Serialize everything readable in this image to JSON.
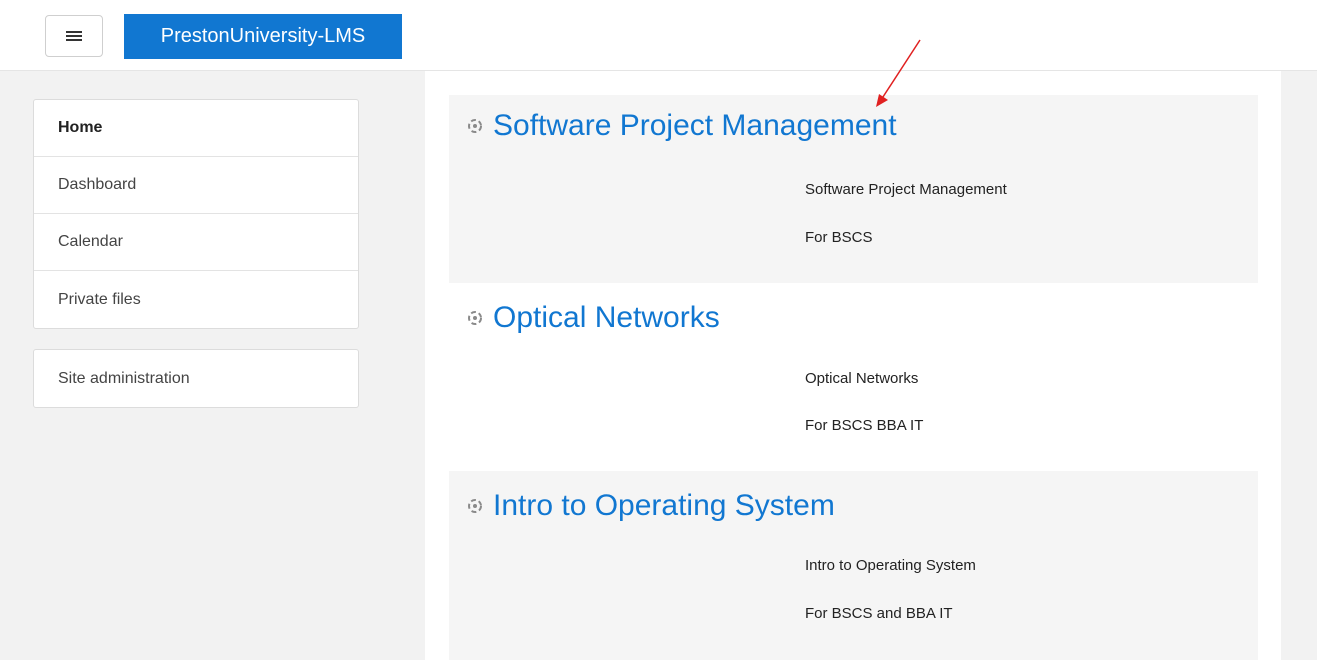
{
  "navbar": {
    "brand": "PrestonUniversity-LMS"
  },
  "sidebar": {
    "items": [
      {
        "label": "Home"
      },
      {
        "label": "Dashboard"
      },
      {
        "label": "Calendar"
      },
      {
        "label": "Private files"
      }
    ],
    "admin": {
      "label": "Site administration"
    }
  },
  "courses": [
    {
      "title": "Software Project Management",
      "name": "Software Project Management",
      "audience": "For BSCS"
    },
    {
      "title": "Optical Networks",
      "name": "Optical Networks",
      "audience": "For BSCS BBA IT"
    },
    {
      "title": "Intro to Operating System",
      "name": "Intro to Operating System",
      "audience": "For BSCS and BBA IT"
    }
  ],
  "colors": {
    "accent": "#1177d1",
    "annotation_arrow": "#e02020"
  },
  "icons": {
    "nav_toggle": "hamburger-icon",
    "course": "course-icon"
  }
}
